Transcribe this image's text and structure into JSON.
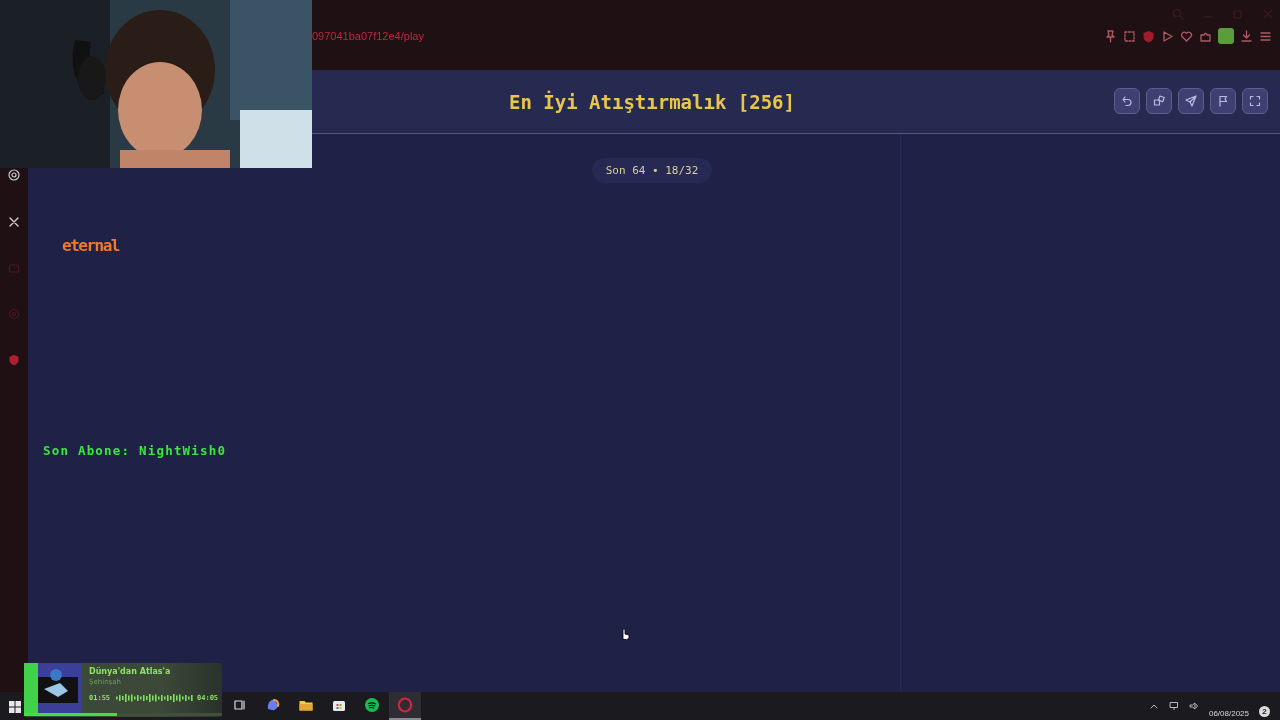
{
  "browser": {
    "url": "097041ba07f12e4/play"
  },
  "game": {
    "title": "En İyi Atıştırmalık [256]",
    "round_badge": "Son 64 • 18/32"
  },
  "overlay": {
    "logo_text": "eternal",
    "last_sub": "Son Abone: NightWish0",
    "music": {
      "title": "Dünya'dan Atlas'a",
      "artist": "Şehinşah",
      "elapsed": "01:55",
      "duration": "04:05",
      "level": 0.47
    }
  },
  "taskbar": {
    "apps": [
      {
        "kind": "taskview",
        "selected": false
      },
      {
        "kind": "copilot",
        "selected": false
      },
      {
        "kind": "folder",
        "selected": false
      },
      {
        "kind": "store",
        "selected": false
      },
      {
        "kind": "spotify",
        "selected": false
      },
      {
        "kind": "opera",
        "selected": true
      }
    ],
    "date": "06/08/2025",
    "notification_count": "2"
  }
}
